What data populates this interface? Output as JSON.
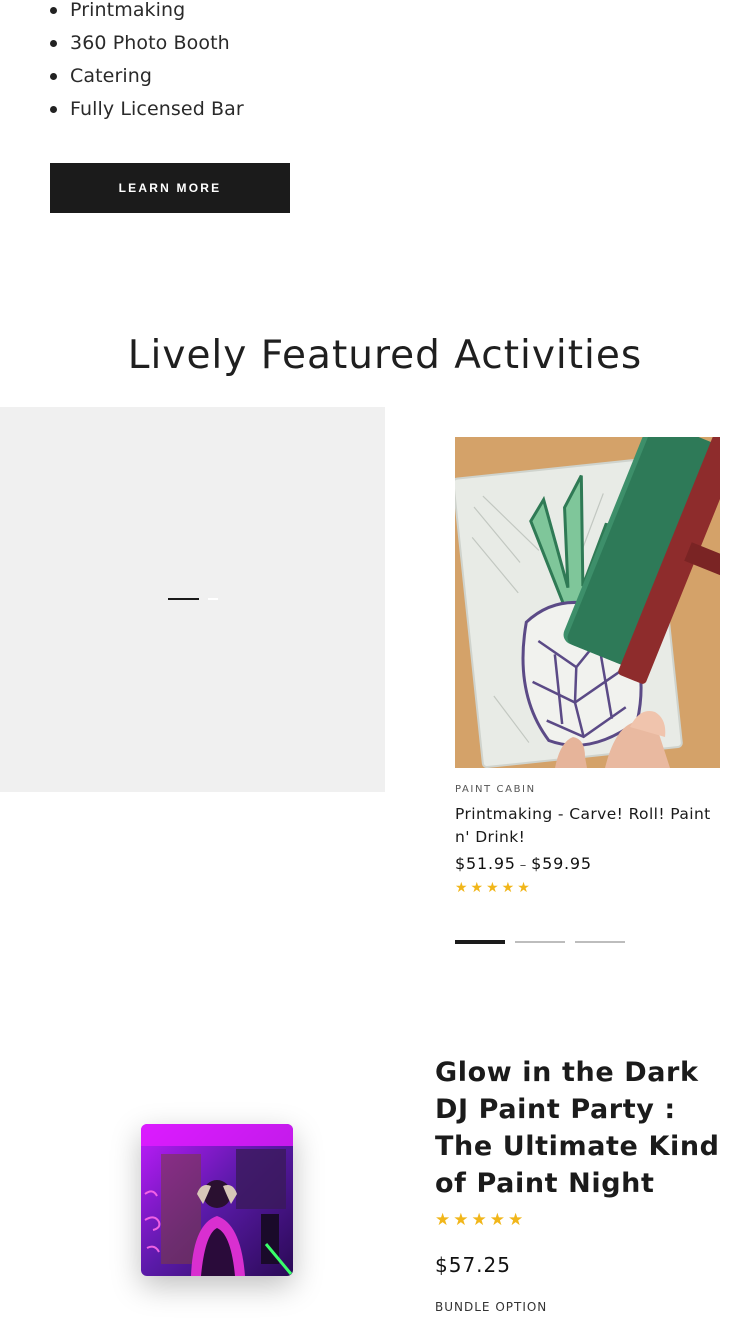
{
  "features": {
    "items": [
      "Printmaking",
      "360 Photo Booth",
      "Catering",
      "Fully Licensed Bar"
    ]
  },
  "cta": {
    "learn_more_label": "LEARN MORE"
  },
  "featured": {
    "title": "Lively Featured Activities",
    "product": {
      "vendor": "PAINT CABIN",
      "title": "Printmaking - Carve! Roll! Paint n' Drink!",
      "price_min": "$51.95",
      "price_sep": "–",
      "price_max": "$59.95",
      "stars": "★★★★★",
      "rating": 5
    },
    "slider": {
      "count": 3,
      "active_index": 0
    }
  },
  "party": {
    "title": "Glow in the Dark DJ Paint Party : The Ultimate Kind of Paint Night",
    "stars": "★★★★★",
    "rating": 5,
    "price": "$57.25",
    "bundle_label": "BUNDLE OPTION"
  },
  "colors": {
    "button_bg": "#1b1b1b",
    "star": "#f1b61a",
    "placeholder_bg": "#f0f0f0",
    "neon_pink": "#ff3df2",
    "neon_purple": "#7a1cff"
  },
  "icons": {
    "bullet": "bullet-dot-icon",
    "star": "star-icon"
  }
}
